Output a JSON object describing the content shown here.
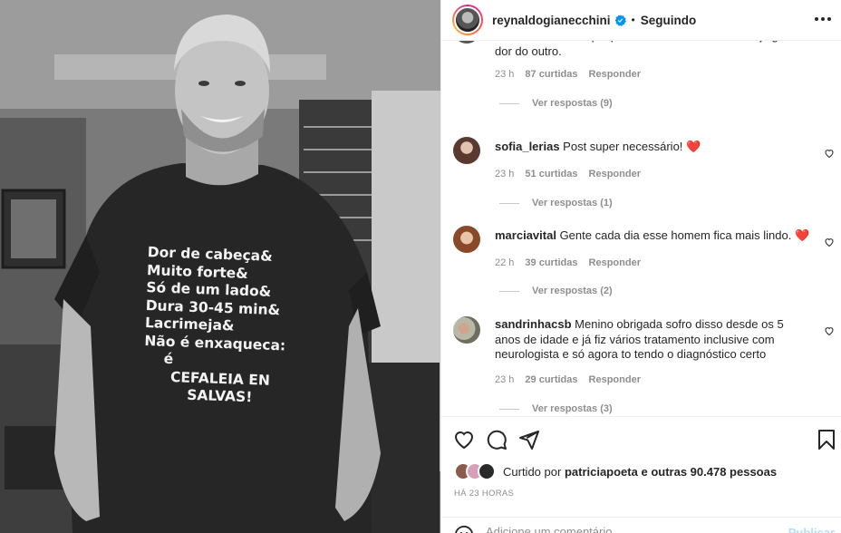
{
  "post": {
    "username": "reynaldogianecchini",
    "follow_status": "Seguindo",
    "separator": "•",
    "shirt_lines": [
      "Dor de cabeça&",
      "Muito forte&",
      "Só de um lado&",
      "Dura 30-45 min&",
      "Lacrimeja&",
      "Não é enxaqueca:",
      "é",
      "CEFALEIA EN",
      "SALVAS!"
    ]
  },
  "comments": [
    {
      "username": "",
      "text": "morro😔 uma dor que paralisou a minha vida. Não julguem a dor do outro.",
      "time": "23 h",
      "likes": "87 curtidas",
      "reply": "Responder",
      "view_replies": "Ver respostas (9)"
    },
    {
      "username": "sofia_lerias",
      "text": "Post super necessário! ❤️",
      "time": "23 h",
      "likes": "51 curtidas",
      "reply": "Responder",
      "view_replies": "Ver respostas (1)"
    },
    {
      "username": "marciavital",
      "text": "Gente cada dia esse homem fica mais lindo. ❤️",
      "time": "22 h",
      "likes": "39 curtidas",
      "reply": "Responder",
      "view_replies": "Ver respostas (2)"
    },
    {
      "username": "sandrinhacsb",
      "text": "Menino obrigada sofro disso desde os 5 anos de idade e já fiz vários tratamento inclusive com neurologista e só agora to tendo o diagnóstico certo",
      "time": "23 h",
      "likes": "29 curtidas",
      "reply": "Responder",
      "view_replies": "Ver respostas (3)"
    }
  ],
  "likes_summary": {
    "prefix": "Curtido por",
    "user": "patriciapoeta",
    "suffix": "e outras 90.478 pessoas"
  },
  "time_ago": "HÁ 23 HORAS",
  "add_comment": {
    "placeholder": "Adicione um comentário...",
    "publish": "Publicar"
  },
  "icons": {
    "like": "heart-icon",
    "comment": "comment-icon",
    "share": "share-icon",
    "save": "bookmark-icon",
    "more": "more-icon",
    "verified": "verified-badge-icon",
    "emoji": "emoji-icon"
  },
  "colors": {
    "heart_red": "#ed4956",
    "verified_blue": "#0095f6",
    "muted": "#8e8e8e",
    "publish_disabled": "#b2dffc"
  }
}
